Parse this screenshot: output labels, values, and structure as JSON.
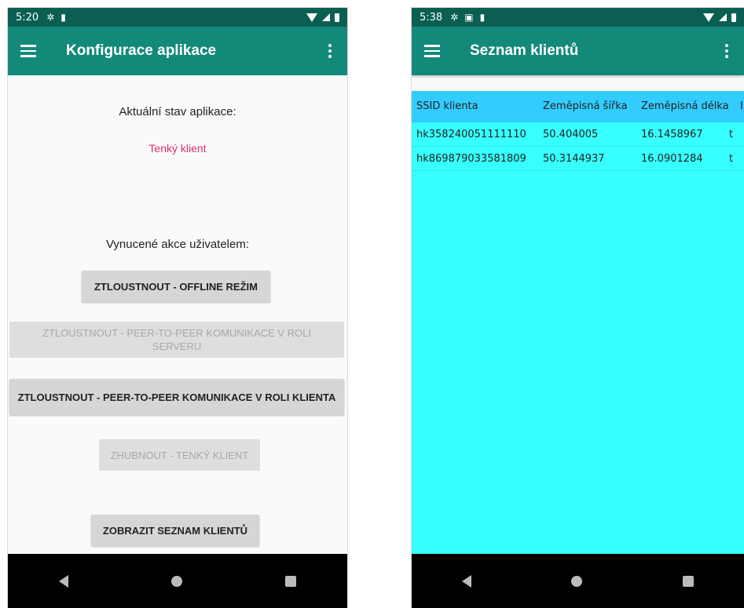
{
  "left": {
    "status": {
      "time": "5:20"
    },
    "appbar_title": "Konfigurace aplikace",
    "state_label": "Aktuální stav aplikace:",
    "state_value": "Tenký klient",
    "forced_label": "Vynucené akce uživatelem:",
    "buttons": {
      "offline": "ZTLOUSTNOUT - OFFLINE REŽIM",
      "p2p_server": "ZTLOUSTNOUT - PEER-TO-PEER KOMUNIKACE V ROLI SERVERU",
      "p2p_client": "ZTLOUSTNOUT - PEER-TO-PEER KOMUNIKACE V ROLI KLIENTA",
      "thin": "ZHUBNOUT - TENKÝ KLIENT",
      "show_list": "ZOBRAZIT SEZNAM KLIENTŮ"
    }
  },
  "right": {
    "status": {
      "time": "5:38"
    },
    "appbar_title": "Seznam klientů",
    "table": {
      "headers": [
        "SSID klienta",
        "Zeměpisná šířka",
        "Zeměpisná délka",
        "I"
      ],
      "rows": [
        [
          "hk358240051111110",
          "50.404005",
          "16.1458967",
          "t"
        ],
        [
          "hk869879033581809",
          "50.3144937",
          "16.0901284",
          "t"
        ]
      ]
    }
  },
  "colors": {
    "statusbar": "#0b5f52",
    "appbar": "#13897a",
    "accent_text": "#e0306a",
    "table_bg": "#38ffff",
    "table_header": "#33ccff"
  },
  "icons": [
    "menu-icon",
    "overflow-menu-icon",
    "settings-icon",
    "sdcard-icon",
    "wifi-icon",
    "signal-icon",
    "battery-icon",
    "back-icon",
    "home-icon",
    "recents-icon"
  ]
}
